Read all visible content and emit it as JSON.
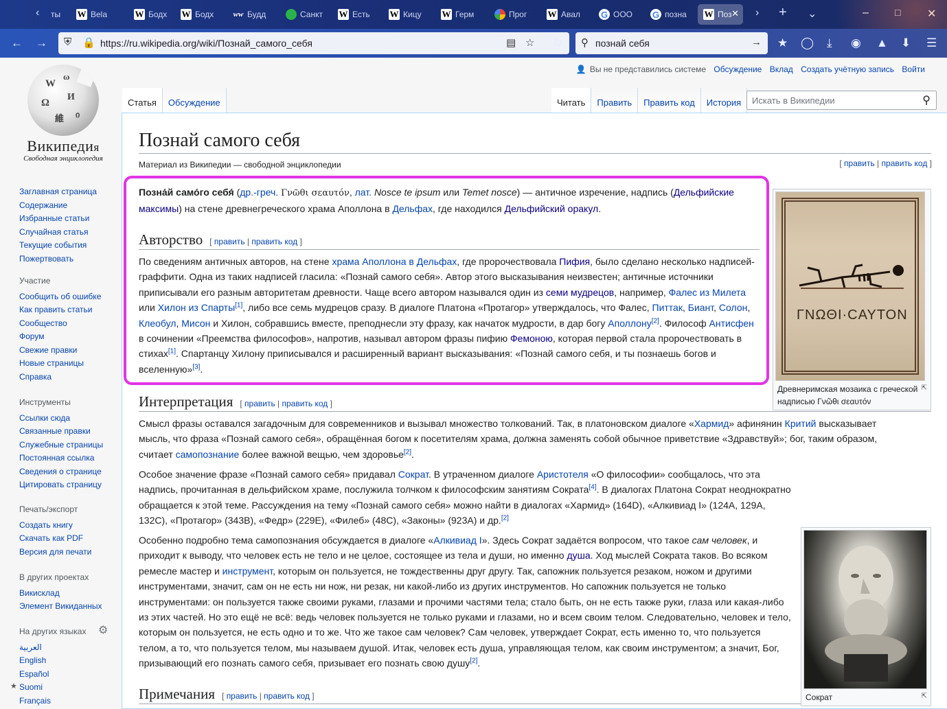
{
  "browser": {
    "tabs": [
      {
        "icon": "W",
        "title": "Bela"
      },
      {
        "icon": "W",
        "title": "Бодх"
      },
      {
        "icon": "W",
        "title": "Бодх"
      },
      {
        "icon": "wr",
        "title": "Будд"
      },
      {
        "icon": "pin",
        "title": "Санкт"
      },
      {
        "icon": "W",
        "title": "Есть"
      },
      {
        "icon": "W",
        "title": "Кицу"
      },
      {
        "icon": "W",
        "title": "Герм"
      },
      {
        "icon": "mc",
        "title": "Прог"
      },
      {
        "icon": "W",
        "title": "Авал"
      },
      {
        "icon": "G",
        "title": "ООО"
      },
      {
        "icon": "G",
        "title": "позна"
      },
      {
        "icon": "W",
        "title": "Поз"
      }
    ],
    "url": "https://ru.wikipedia.org/wiki/Познай_самого_себя",
    "search_query": "познай себя"
  },
  "logo": {
    "wordmark_big": "Википеди",
    "wordmark_end": "я",
    "tagline": "Свободная энциклопедия"
  },
  "personal": {
    "not_logged": "Вы не представились системе",
    "talk": "Обсуждение",
    "contrib": "Вклад",
    "create": "Создать учётную запись",
    "login": "Войти"
  },
  "tabs": {
    "article": "Статья",
    "talk": "Обсуждение",
    "read": "Читать",
    "edit": "Править",
    "edit_source": "Править код",
    "history": "История"
  },
  "search": {
    "placeholder": "Искать в Википедии"
  },
  "sidebar": {
    "nav": [
      "Заглавная страница",
      "Содержание",
      "Избранные статьи",
      "Случайная статья",
      "Текущие события",
      "Пожертвовать"
    ],
    "participation_heading": "Участие",
    "participation": [
      "Сообщить об ошибке",
      "Как править статьи",
      "Сообщество",
      "Форум",
      "Свежие правки",
      "Новые страницы",
      "Справка"
    ],
    "tools_heading": "Инструменты",
    "tools": [
      "Ссылки сюда",
      "Связанные правки",
      "Служебные страницы",
      "Постоянная ссылка",
      "Сведения о странице",
      "Цитировать страницу"
    ],
    "print_heading": "Печать/экспорт",
    "print": [
      "Создать книгу",
      "Скачать как PDF",
      "Версия для печати"
    ],
    "projects_heading": "В других проектах",
    "projects": [
      "Викисклад",
      "Элемент Викиданных"
    ],
    "langs_heading": "На других языках",
    "langs": [
      "العربية",
      "English",
      "Español",
      "Suomi",
      "Français"
    ]
  },
  "article": {
    "title": "Познай самого себя",
    "sitesub": "Материал из Википедии — свободной энциклопедии",
    "edit": "править",
    "edit_code": "править код",
    "h_author": "Авторство",
    "h_interp": "Интерпретация",
    "h_notes": "Примечания",
    "fig1_caption": "Древнеримская мозаика с греческой надписью Γνῶθι σεαυτόν",
    "fig1_inscription": "ΓΝΩΘΙ·CAYTON",
    "fig2_caption": "Сократ"
  }
}
